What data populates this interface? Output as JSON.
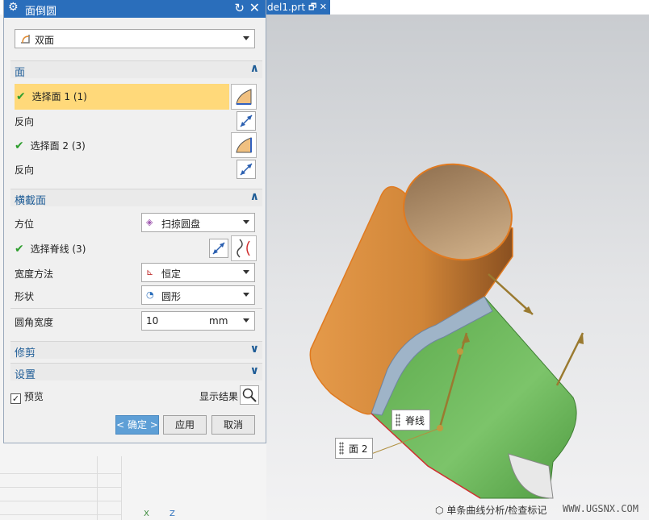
{
  "file_tab": {
    "label": "del1.prt",
    "icons": "🗗 ✕"
  },
  "dialog": {
    "title": "面倒圆",
    "type_select": {
      "value": "双面"
    },
    "face_section": {
      "title": "面",
      "select_face1": "选择面 1 (1)",
      "reverse1": "反向",
      "select_face2": "选择面 2 (3)",
      "reverse2": "反向"
    },
    "cross_section": {
      "title": "横截面",
      "orientation_label": "方位",
      "orientation_value": "扫掠圆盘",
      "select_spine": "选择脊线 (3)",
      "width_method_label": "宽度方法",
      "width_method_value": "恒定",
      "shape_label": "形状",
      "shape_value": "圆形",
      "radius_label": "圆角宽度",
      "radius_value": "10",
      "radius_unit": "mm"
    },
    "trim_section": {
      "title": "修剪"
    },
    "settings_section": {
      "title": "设置"
    },
    "preview_label": "预览",
    "preview_checked": true,
    "show_result_label": "显示结果",
    "ok_label": "< 确定 >",
    "apply_label": "应用",
    "cancel_label": "取消"
  },
  "viewport": {
    "spine_tag": "脊线",
    "face2_tag": "面 2",
    "status_text": "单条曲线分析/检查标记",
    "watermark": "WWW.UGSNX.COM",
    "triad_x": "X",
    "triad_z": "Z"
  },
  "colors": {
    "title_bar": "#2a6ebb",
    "highlight": "#ffd97a",
    "orange_face": "#d98a3d",
    "green_face": "#6fb85a",
    "blend_face": "#8fa6c0"
  }
}
